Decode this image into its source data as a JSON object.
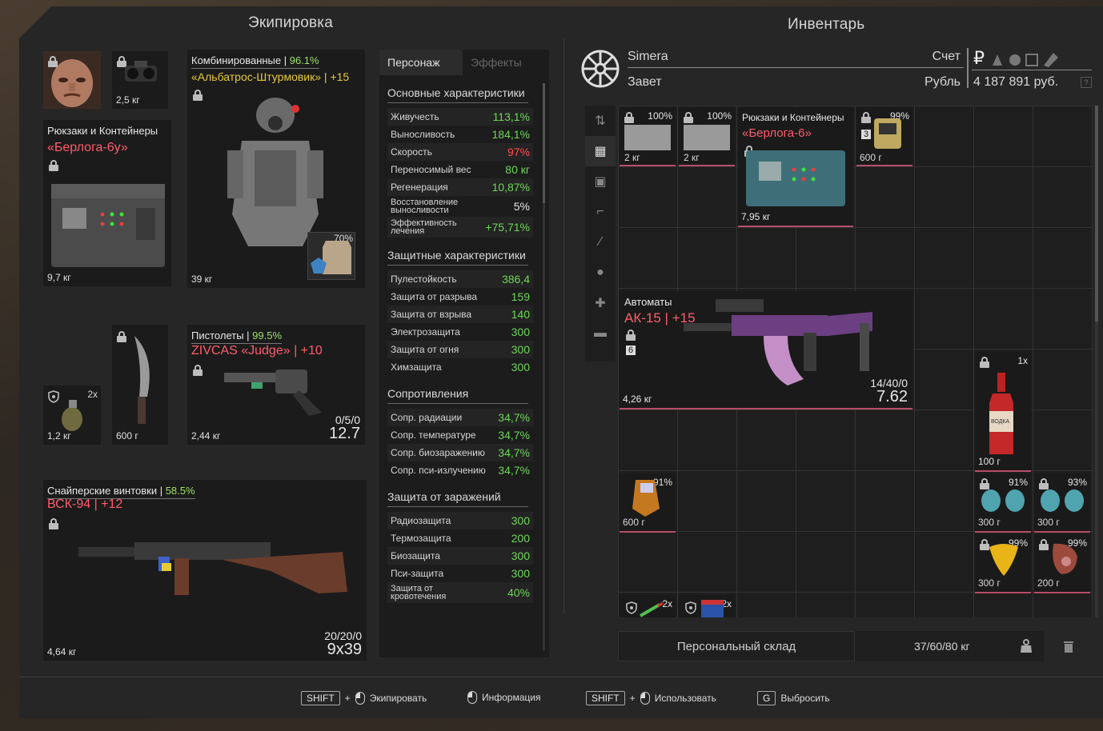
{
  "equipment": {
    "title": "Экипировка",
    "device": {
      "weight": "2,5 кг"
    },
    "backpack": {
      "category": "Рюкзаки и Контейнеры",
      "name": "«Берлога-6у»",
      "weight": "9,7 кг"
    },
    "armor": {
      "category": "Комбинированные",
      "durability": "96.1%",
      "name": "«Альбатрос-Штурмовик»",
      "upgrade": "+15",
      "weight": "39 кг",
      "plate_pct": "70%"
    },
    "grenade": {
      "count": "2x",
      "weight": "1,2 кг"
    },
    "knife": {
      "weight": "600 г"
    },
    "pistol": {
      "category": "Пистолеты",
      "durability": "99.5%",
      "name": "ZIVCAS «Judge»",
      "upgrade": "+10",
      "weight": "2,44 кг",
      "ammo": "0/5/0",
      "caliber": "12.7"
    },
    "sniper": {
      "category": "Снайперские винтовки",
      "durability": "58.5%",
      "name": "ВСК-94",
      "upgrade": "+12",
      "weight": "4,64 кг",
      "ammo": "20/20/0",
      "caliber": "9x39"
    }
  },
  "stats": {
    "tabs": [
      "Персонаж",
      "Эффекты"
    ],
    "groups": [
      {
        "title": "Основные характеристики",
        "rows": [
          {
            "k": "Живучесть",
            "v": "113,1%",
            "c": "green"
          },
          {
            "k": "Выносливость",
            "v": "184,1%",
            "c": "green"
          },
          {
            "k": "Скорость",
            "v": "97%",
            "c": "red"
          },
          {
            "k": "Переносимый вес",
            "v": "80 кг",
            "c": "green"
          },
          {
            "k": "Регенерация",
            "v": "10,87%",
            "c": "green"
          },
          {
            "k": "Восстановление выносливости",
            "v": "5%",
            "c": "white",
            "small": true
          },
          {
            "k": "Эффективность лечения",
            "v": "+75,71%",
            "c": "green",
            "small": true
          }
        ]
      },
      {
        "title": "Защитные характеристики",
        "rows": [
          {
            "k": "Пулестойкость",
            "v": "386,4",
            "c": "green"
          },
          {
            "k": "Защита от разрыва",
            "v": "159",
            "c": "green"
          },
          {
            "k": "Защита от взрыва",
            "v": "140",
            "c": "green"
          },
          {
            "k": "Электрозащита",
            "v": "300",
            "c": "green"
          },
          {
            "k": "Защита от огня",
            "v": "300",
            "c": "green"
          },
          {
            "k": "Химзащита",
            "v": "300",
            "c": "green"
          }
        ]
      },
      {
        "title": "Сопротивления",
        "rows": [
          {
            "k": "Сопр. радиации",
            "v": "34,7%",
            "c": "green"
          },
          {
            "k": "Сопр. температуре",
            "v": "34,7%",
            "c": "green"
          },
          {
            "k": "Сопр. биозаражению",
            "v": "34,7%",
            "c": "green"
          },
          {
            "k": "Сопр. пси-излучению",
            "v": "34,7%",
            "c": "green"
          }
        ]
      },
      {
        "title": "Защита от заражений",
        "rows": [
          {
            "k": "Радиозащита",
            "v": "300",
            "c": "green"
          },
          {
            "k": "Термозащита",
            "v": "200",
            "c": "green"
          },
          {
            "k": "Биозащита",
            "v": "300",
            "c": "green"
          },
          {
            "k": "Пси-защита",
            "v": "300",
            "c": "green"
          },
          {
            "k": "Защита от кровотечения",
            "v": "40%",
            "c": "green",
            "small": true
          }
        ]
      }
    ]
  },
  "inventory": {
    "title": "Инвентарь",
    "player": "Simera",
    "faction": "Завет",
    "account_label": "Счет",
    "currency_label": "Рубль",
    "balance": "4 187 891 руб.",
    "currency_symbol": "₽",
    "help": "?",
    "items": {
      "slot1": {
        "pct": "100%",
        "weight": "2 кг"
      },
      "slot2": {
        "pct": "100%",
        "weight": "2 кг"
      },
      "container": {
        "category": "Рюкзаки и Контейнеры",
        "name": "«Берлога-6»",
        "weight": "7,95 кг"
      },
      "device": {
        "pct": "99%",
        "count": "3",
        "weight": "600 г"
      },
      "rifle": {
        "category": "Автоматы",
        "name": "АК-15",
        "upgrade": "+15",
        "mods": "6",
        "weight": "4,26 кг",
        "ammo": "14/40/0",
        "caliber": "7.62"
      },
      "bottle": {
        "count": "1x",
        "weight": "100 г",
        "label": "ВОДКА"
      },
      "detector": {
        "pct": "91%",
        "weight": "600 г"
      },
      "art1": {
        "pct": "91%",
        "weight": "300 г"
      },
      "art2": {
        "pct": "93%",
        "weight": "300 г"
      },
      "art3": {
        "pct": "99%",
        "weight": "300 г"
      },
      "art4": {
        "pct": "99%",
        "weight": "200 г"
      },
      "stack1": {
        "count": "2x"
      },
      "stack2": {
        "count": "2x"
      }
    },
    "storage_label": "Персональный склад",
    "weight_summary": "37/60/80 кг"
  },
  "hints": [
    {
      "key": "SHIFT",
      "label": "Экипировать"
    },
    {
      "label": "Информация"
    },
    {
      "key": "SHIFT",
      "label": "Использовать"
    },
    {
      "key": "G",
      "label": "Выбросить"
    }
  ],
  "colors": {
    "accent_red": "#ff5d6c",
    "green": "#6fd65a",
    "yellow": "#e6c93a",
    "item_underline": "#b74d6b"
  }
}
